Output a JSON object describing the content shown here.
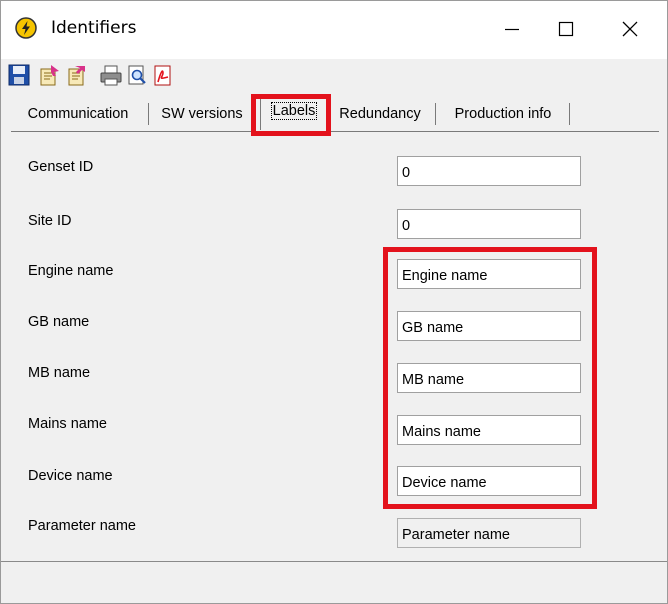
{
  "window": {
    "title": "Identifiers",
    "controls": {
      "minimize": "minimize-icon",
      "maximize": "maximize-icon",
      "close": "close-icon"
    }
  },
  "toolbar": {
    "icons": [
      "save-icon",
      "import-icon",
      "export-icon",
      "print-icon",
      "print-preview-icon",
      "pdf-export-icon"
    ]
  },
  "tabs": [
    {
      "label": "Communication",
      "selected": false
    },
    {
      "label": "SW versions",
      "selected": false
    },
    {
      "label": "Labels",
      "selected": true
    },
    {
      "label": "Redundancy",
      "selected": false
    },
    {
      "label": "Production info",
      "selected": false
    }
  ],
  "fields": [
    {
      "label": "Genset ID",
      "value": "0",
      "editable": true
    },
    {
      "label": "Site ID",
      "value": "0",
      "editable": true
    },
    {
      "label": "Engine name",
      "value": "Engine name",
      "editable": true
    },
    {
      "label": "GB name",
      "value": "GB name",
      "editable": true
    },
    {
      "label": "MB name",
      "value": "MB name",
      "editable": true
    },
    {
      "label": "Mains name",
      "value": "Mains name",
      "editable": true
    },
    {
      "label": "Device name",
      "value": "Device name",
      "editable": true
    },
    {
      "label": "Parameter name",
      "value": "Parameter name",
      "editable": false
    }
  ],
  "colors": {
    "highlight": "#e3121c",
    "window_bg": "#f0f0f0",
    "titlebar_bg": "#ffffff"
  }
}
